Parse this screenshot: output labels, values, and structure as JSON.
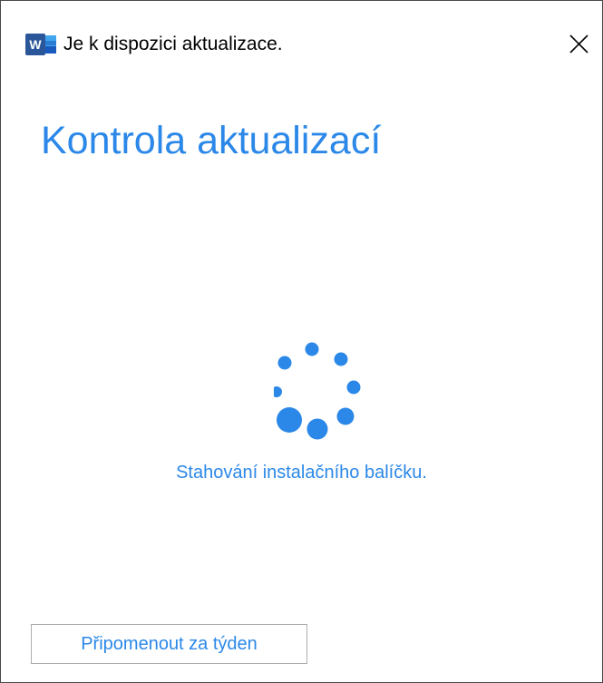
{
  "window": {
    "title": "Je k dispozici aktualizace.",
    "app_icon": "word-icon",
    "close_icon": "close-icon"
  },
  "main": {
    "heading": "Kontrola aktualizací",
    "spinner_icon": "loading-spinner-icon",
    "status": "Stahování instalačního balíčku."
  },
  "footer": {
    "remind_label": "Připomenout za týden"
  },
  "colors": {
    "accent": "#2b88e8",
    "word_blue": "#2b579a"
  }
}
